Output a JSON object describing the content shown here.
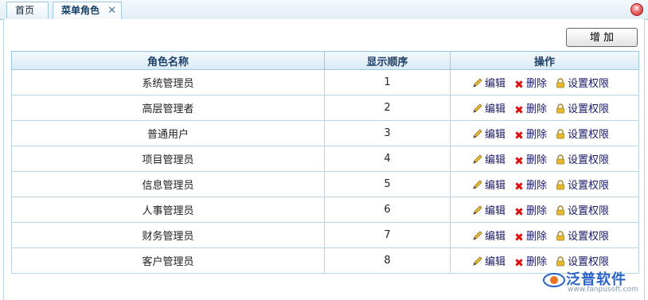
{
  "tabs": [
    {
      "label": "首页"
    },
    {
      "label": "菜单角色"
    }
  ],
  "toolbar": {
    "add_label": "增 加"
  },
  "table": {
    "headers": [
      "角色名称",
      "显示顺序",
      "操作"
    ],
    "rows": [
      {
        "name": "系统管理员",
        "order": "1"
      },
      {
        "name": "高层管理者",
        "order": "2"
      },
      {
        "name": "普通用户",
        "order": "3"
      },
      {
        "name": "项目管理员",
        "order": "4"
      },
      {
        "name": "信息管理员",
        "order": "5"
      },
      {
        "name": "人事管理员",
        "order": "6"
      },
      {
        "name": "财务管理员",
        "order": "7"
      },
      {
        "name": "客户管理员",
        "order": "8"
      }
    ],
    "actions": {
      "edit": "编辑",
      "delete": "删除",
      "perm": "设置权限"
    }
  },
  "watermark": {
    "brand": "泛普软件",
    "url": "www.fanpusoft.com"
  },
  "colors": {
    "accent": "#1e3f66",
    "border": "#9ec6dc",
    "delete": "#e01010"
  }
}
